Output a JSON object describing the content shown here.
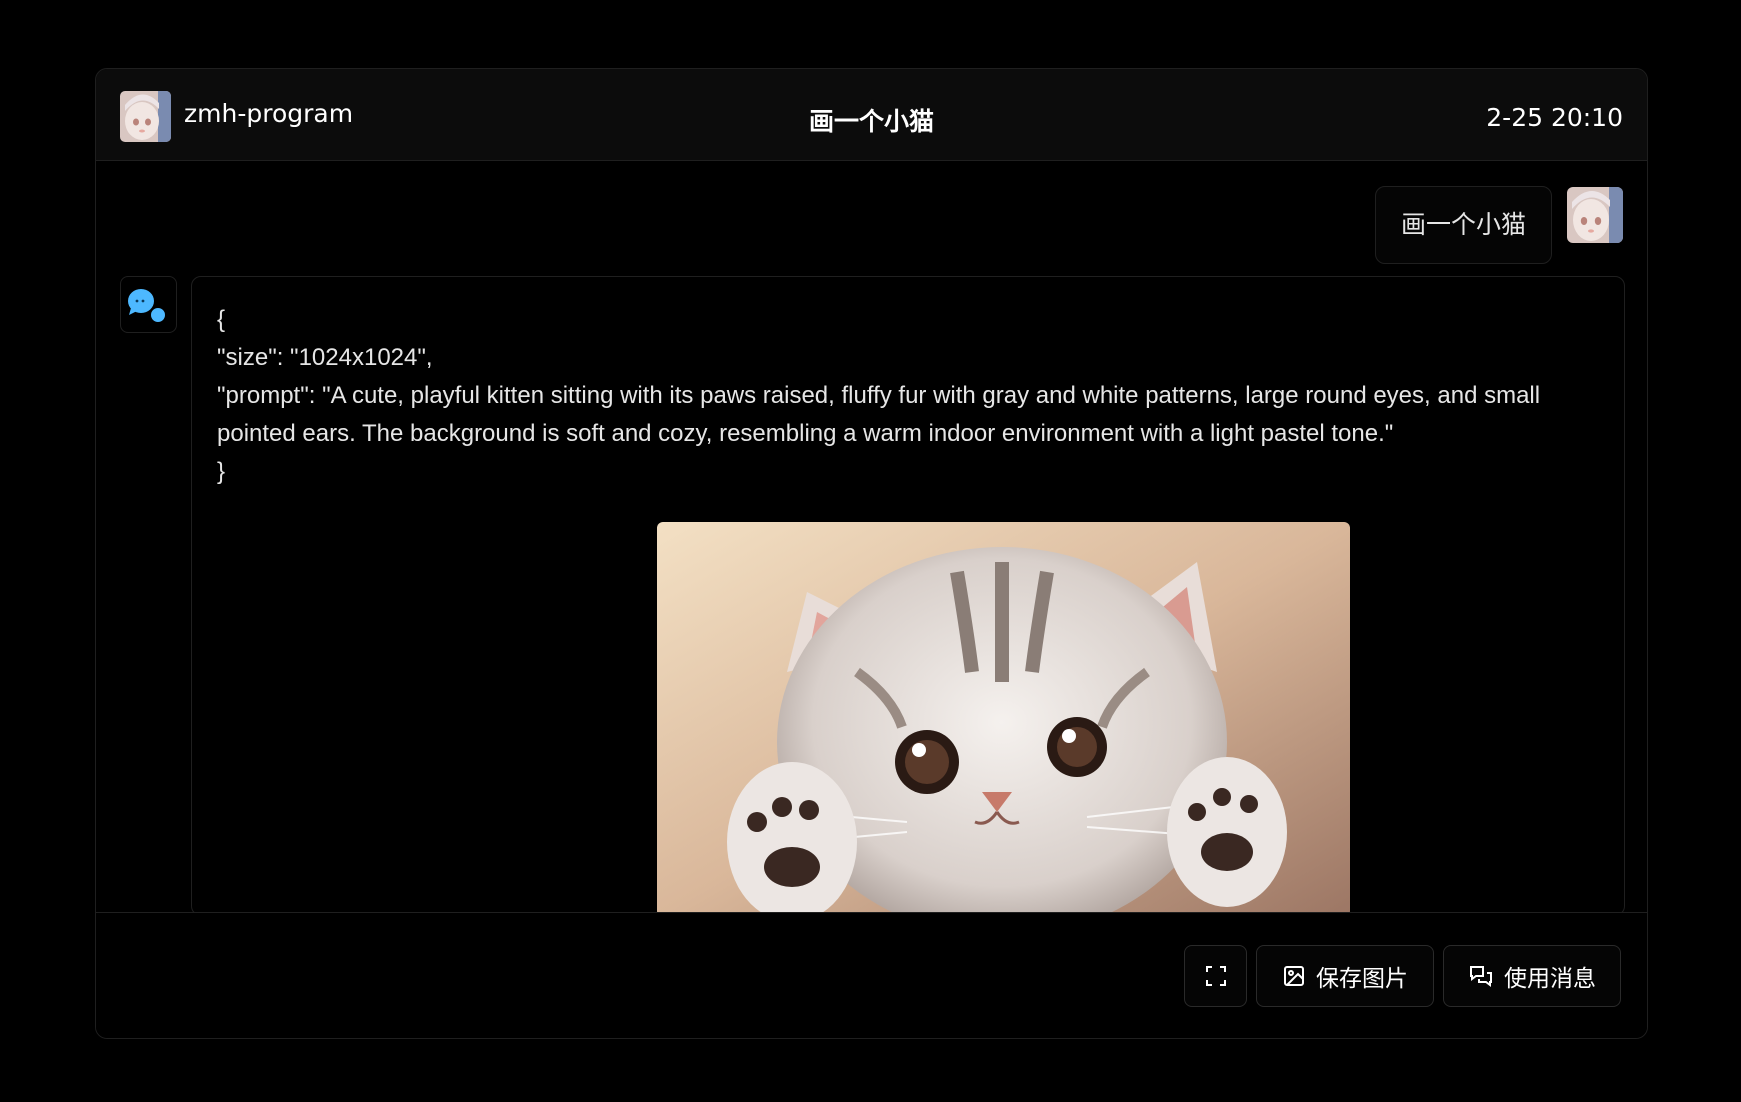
{
  "header": {
    "username": "zmh-program",
    "title": "画一个小猫",
    "timestamp": "2-25 20:10"
  },
  "messages": {
    "user_text": "画一个小猫",
    "bot_lines": [
      "{",
      "\"size\": \"1024x1024\",",
      "\"prompt\": \"A cute, playful kitten sitting with its paws raised, fluffy fur with gray and white patterns, large round eyes, and small pointed ears. The background is soft and cozy, resembling a warm indoor environment with a light pastel tone.\"",
      "}"
    ]
  },
  "footer": {
    "save_label": "保存图片",
    "use_label": "使用消息"
  },
  "icons": {
    "fullscreen": "fullscreen-icon",
    "save": "image-icon",
    "use": "message-icon",
    "bot": "chat-bubble-icon"
  },
  "colors": {
    "background": "#000000",
    "header_bg": "#0c0c0c",
    "border": "#1f1f1f",
    "text": "#e6e6e6",
    "bot_icon": "#4db8ff"
  }
}
